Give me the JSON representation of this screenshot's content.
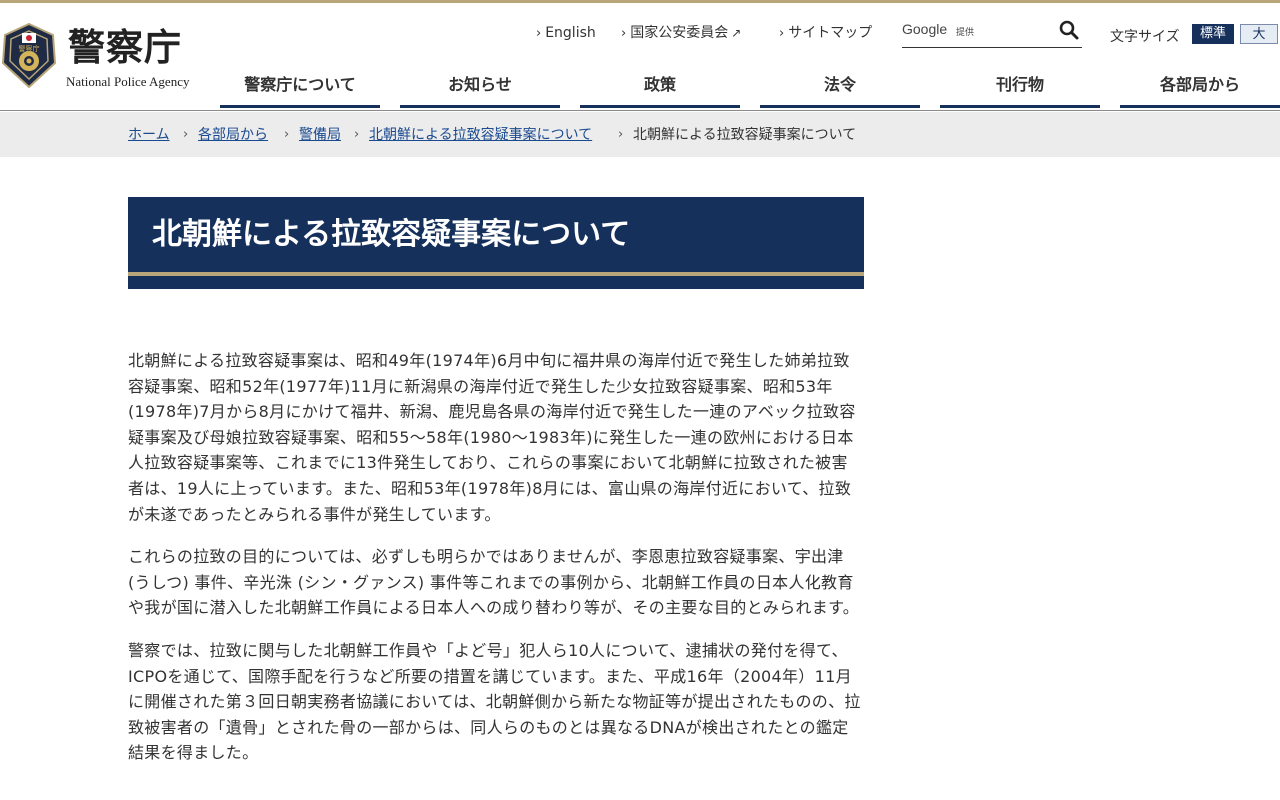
{
  "header": {
    "logo_text": "警察庁",
    "logo_subtext": "National Police Agency",
    "util_links": [
      {
        "label": "English"
      },
      {
        "label": "国家公安委員会"
      },
      {
        "label": "サイトマップ"
      }
    ],
    "search": {
      "google_label": "Google",
      "provider_label": "提供",
      "value": ""
    },
    "font_size": {
      "label": "文字サイズ",
      "standard": "標準",
      "large": "大"
    },
    "nav": [
      {
        "label": "警察庁について"
      },
      {
        "label": "お知らせ"
      },
      {
        "label": "政策"
      },
      {
        "label": "法令"
      },
      {
        "label": "刊行物"
      },
      {
        "label": "各部局から"
      }
    ]
  },
  "breadcrumb": [
    {
      "label": "ホーム"
    },
    {
      "label": "各部局から"
    },
    {
      "label": "警備局"
    },
    {
      "label": "北朝鮮による拉致容疑事案について"
    },
    {
      "label": "北朝鮮による拉致容疑事案について"
    }
  ],
  "page": {
    "title": "北朝鮮による拉致容疑事案について",
    "paragraphs": [
      "北朝鮮による拉致容疑事案は、昭和49年(1974年)6月中旬に福井県の海岸付近で発生した姉弟拉致容疑事案、昭和52年(1977年)11月に新潟県の海岸付近で発生した少女拉致容疑事案、昭和53年(1978年)7月から8月にかけて福井、新潟、鹿児島各県の海岸付近で発生した一連のアベック拉致容疑事案及び母娘拉致容疑事案、昭和55～58年(1980～1983年)に発生した一連の欧州における日本人拉致容疑事案等、これまでに13件発生しており、これらの事案において北朝鮮に拉致された被害者は、19人に上っています。また、昭和53年(1978年)8月には、富山県の海岸付近において、拉致が未遂であったとみられる事件が発生しています。",
      "これらの拉致の目的については、必ずしも明らかではありませんが、李恩恵拉致容疑事案、宇出津 (うしつ) 事件、辛光洙 (シン・グァンス) 事件等これまでの事例から、北朝鮮工作員の日本人化教育や我が国に潜入した北朝鮮工作員による日本人への成り替わり等が、その主要な目的とみられます。",
      "警察では、拉致に関与した北朝鮮工作員や「よど号」犯人ら10人について、逮捕状の発付を得て、ICPOを通じて、国際手配を行うなど所要の措置を講じています。また、平成16年（2004年）11月に開催された第３回日朝実務者協議においては、北朝鮮側から新たな物証等が提出されたものの、拉致被害者の「遺骨」とされた骨の一部からは、同人らのものとは異なるDNAが検出されたとの鑑定結果を得ました。"
    ]
  },
  "colors": {
    "navy": "#16305c",
    "gold": "#b8a57a",
    "link": "#1a4a8f",
    "breadcrumb_bg": "#ececec"
  }
}
